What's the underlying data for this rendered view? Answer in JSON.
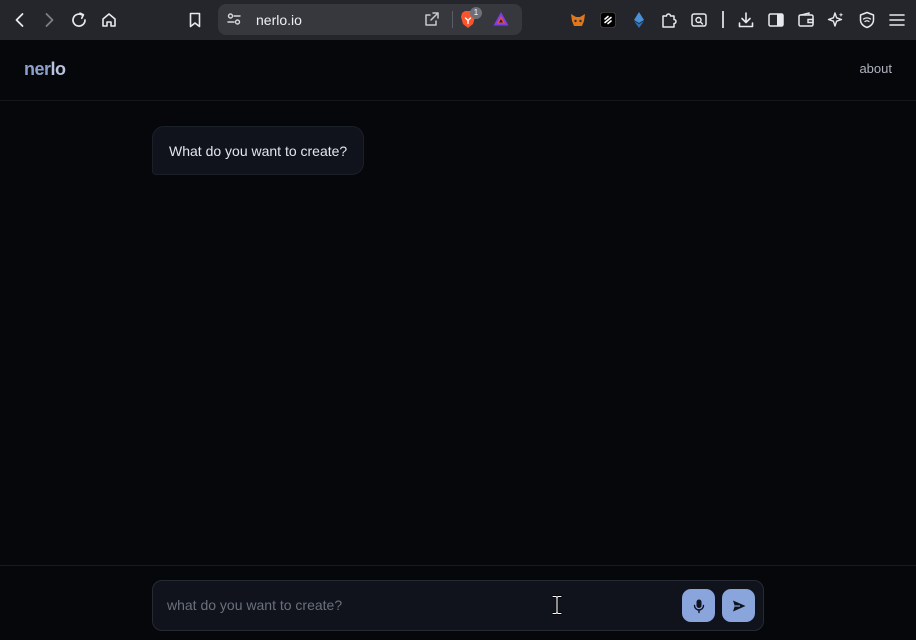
{
  "browser": {
    "url": "nerlo.io",
    "brave_shield_count": "1"
  },
  "header": {
    "logo_part_1": "ner",
    "logo_part_2": "lo",
    "about_label": "about"
  },
  "chat": {
    "messages": [
      {
        "role": "assistant",
        "text": "What do you want to create?"
      }
    ]
  },
  "composer": {
    "value": "",
    "placeholder": "what do you want to create?"
  },
  "icons": {
    "back": "chevron-left-icon",
    "forward": "chevron-right-icon",
    "reload": "reload-icon",
    "home": "home-icon",
    "bookmark": "bookmark-icon",
    "site_settings": "site-settings-icon",
    "share": "share-icon",
    "brave_shields": "brave-lion-icon",
    "brave_rewards": "brave-rewards-icon",
    "extensions": [
      "metamask-fox-icon",
      "extension-icon",
      "ethereum-icon",
      "puzzle-icon",
      "search-page-icon",
      "download-icon",
      "sidebar-icon",
      "wallet-icon",
      "leo-ai-icon",
      "vpn-shield-icon",
      "menu-icon"
    ],
    "mic": "microphone-icon",
    "send": "send-icon"
  },
  "colors": {
    "page_background": "#06070b",
    "browser_bar": "#24262b",
    "accent": "#8aa4dc",
    "bubble_background": "#10131c"
  }
}
